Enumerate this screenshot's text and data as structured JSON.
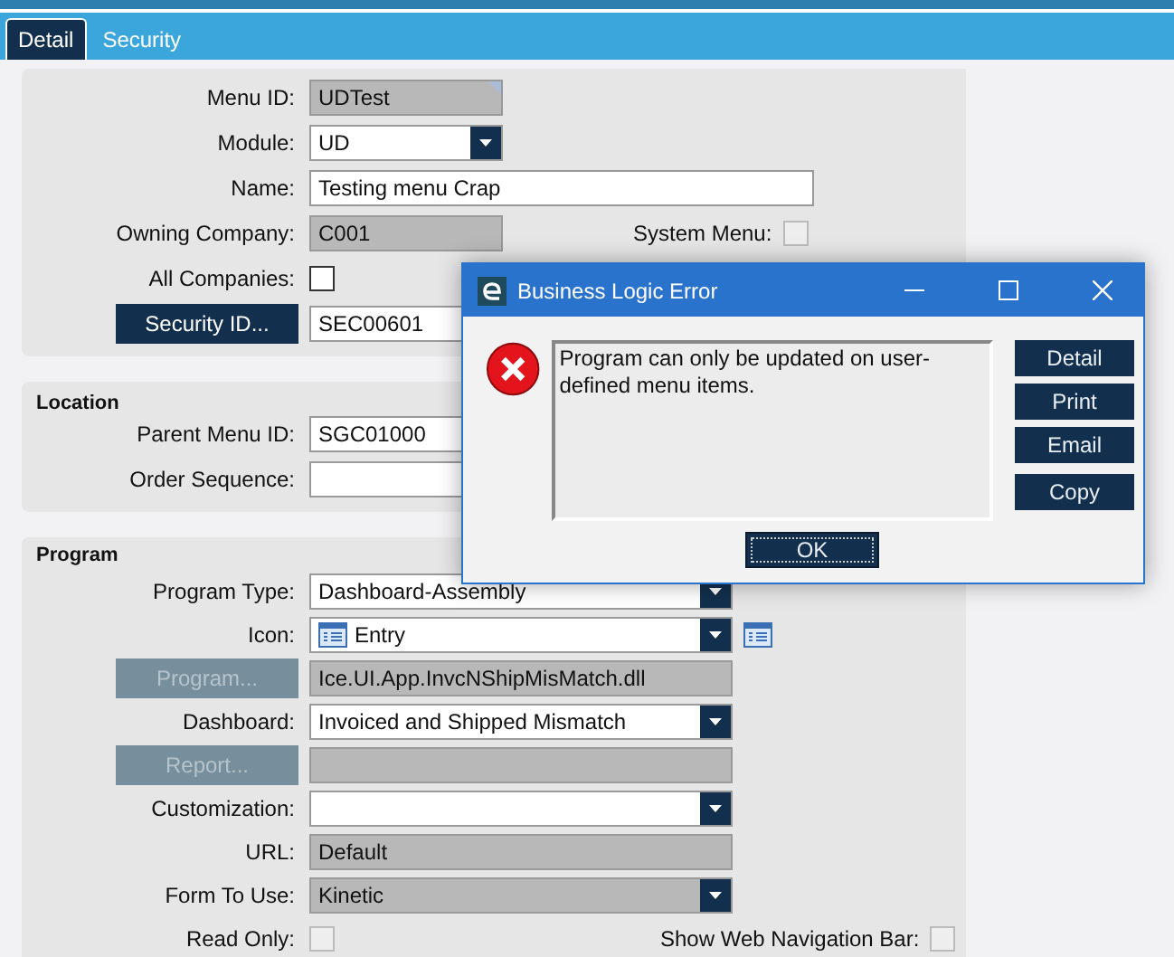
{
  "tabs": [
    {
      "label": "Detail",
      "selected": true
    },
    {
      "label": "Security",
      "selected": false
    }
  ],
  "detail": {
    "fields": [
      {
        "kind": "readonly",
        "label": "Menu ID:",
        "value": "UDTest"
      },
      {
        "kind": "dropdown",
        "label": "Module:",
        "value": "UD"
      },
      {
        "kind": "text",
        "label": "Name:",
        "value": "Testing menu Crap"
      },
      {
        "kind": "readonly",
        "label": "Owning Company:",
        "value": "C001",
        "side_checkbox": {
          "label": "System Menu:",
          "checked": false,
          "disabled": true
        }
      },
      {
        "kind": "checkbox",
        "label": "All Companies:",
        "checked": false
      },
      {
        "kind": "button",
        "button": "Security ID...",
        "disabled": false,
        "value": "SEC00601"
      }
    ]
  },
  "location": {
    "title": "Location",
    "fields": [
      {
        "kind": "text",
        "label": "Parent Menu ID:",
        "value": "SGC01000"
      },
      {
        "kind": "text",
        "label": "Order Sequence:"
      }
    ]
  },
  "program": {
    "title": "Program",
    "fields": [
      {
        "kind": "dropdown",
        "label": "Program Type:",
        "value": "Dashboard-Assembly"
      },
      {
        "kind": "icon-dropdown",
        "label": "Icon:",
        "value": "Entry"
      },
      {
        "kind": "button",
        "button": "Program...",
        "disabled": true,
        "value": "Ice.UI.App.InvcNShipMisMatch.dll"
      },
      {
        "kind": "dropdown",
        "label": "Dashboard:",
        "value": "Invoiced and Shipped Mismatch"
      },
      {
        "kind": "button",
        "button": "Report...",
        "disabled": true
      },
      {
        "kind": "dropdown",
        "label": "Customization:"
      },
      {
        "kind": "readonly",
        "label": "URL:",
        "value": "Default"
      },
      {
        "kind": "readonly-dropdown",
        "label": "Form To Use:",
        "value": "Kinetic"
      },
      {
        "kind": "checkbox",
        "label": "Read Only:",
        "checked": false,
        "disabled": true,
        "side_checkbox": {
          "label": "Show Web Navigation Bar:",
          "checked": false,
          "disabled": true
        }
      }
    ]
  },
  "dialog": {
    "title": "Business Logic Error",
    "message": "Program can only be updated on user-defined menu items.",
    "buttons": [
      "Detail",
      "Print",
      "Email",
      "Copy"
    ],
    "ok": "OK"
  }
}
